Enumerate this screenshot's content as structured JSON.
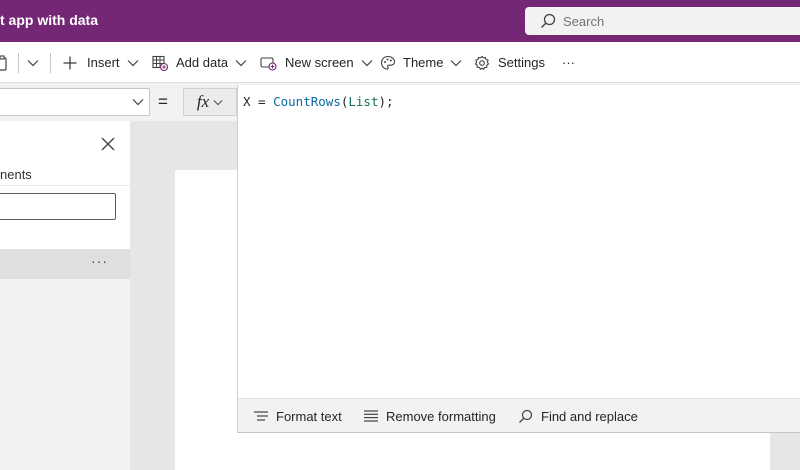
{
  "titlebar": {
    "app_title": "t app with data",
    "search_placeholder": "Search"
  },
  "commandbar": {
    "insert_label": "Insert",
    "add_data_label": "Add data",
    "new_screen_label": "New screen",
    "theme_label": "Theme",
    "settings_label": "Settings",
    "more_label": "···"
  },
  "formula_bar": {
    "equals": "=",
    "fx_label": "fx",
    "code": {
      "var": "X = ",
      "function": "CountRows",
      "open_paren": "(",
      "argument": "List",
      "close": ");"
    }
  },
  "left_panel": {
    "label": "nents",
    "more_label": "···"
  },
  "editor_toolbar": {
    "format_text_label": "Format text",
    "remove_formatting_label": "Remove formatting",
    "find_replace_label": "Find and replace"
  },
  "colors": {
    "brand": "#742774",
    "function_token": "#0b6a9c",
    "reference_token": "#11705a"
  },
  "icons": [
    "search-icon",
    "paste-icon",
    "chevron-down-icon",
    "plus-icon",
    "table-icon",
    "screen-icon",
    "palette-icon",
    "gear-icon",
    "close-icon",
    "format-text-icon",
    "remove-formatting-icon",
    "find-icon"
  ]
}
